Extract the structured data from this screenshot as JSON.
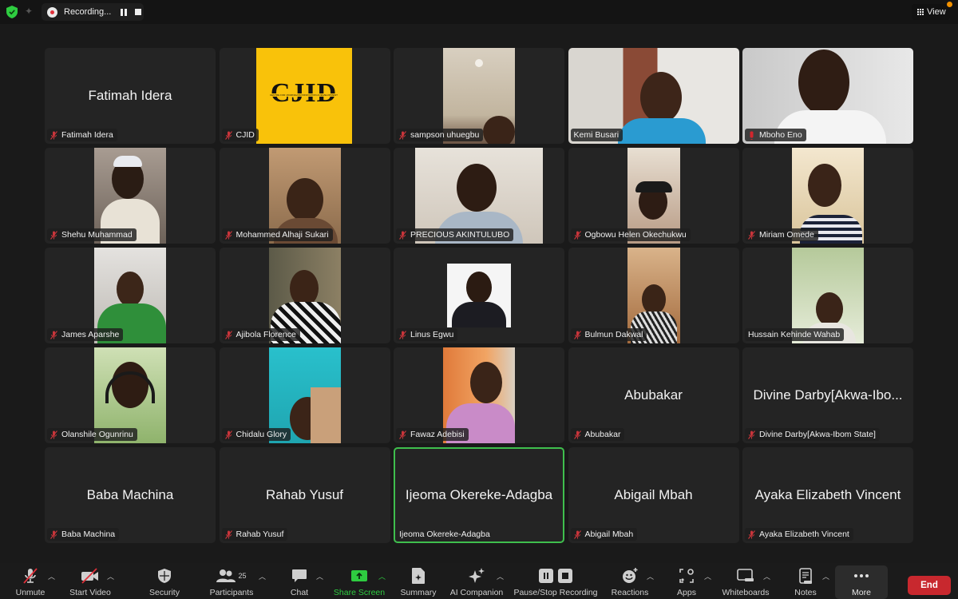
{
  "topbar": {
    "recording_label": "Recording...",
    "view_label": "View",
    "colors": {
      "shield": "#2ecc40",
      "rec_dot": "#e0303a",
      "notify_dot": "#f29100"
    }
  },
  "participants": [
    {
      "display_name": "Fatimah Idera",
      "label": "Fatimah Idera",
      "muted": true,
      "video": false
    },
    {
      "display_name": "CJID",
      "label": "CJID",
      "muted": true,
      "video": true,
      "logo_text": "CJID",
      "logo_subtitle": "CENTRE FOR JOURNALISM INNOVATION & DEVELOPMENT"
    },
    {
      "display_name": "sampson uhuegbu",
      "label": "sampson uhuegbu",
      "muted": true,
      "video": true
    },
    {
      "display_name": "Kemi Busari",
      "label": "Kemi Busari",
      "muted": false,
      "video": true
    },
    {
      "display_name": "Mboho Eno",
      "label": "Mboho Eno",
      "muted": true,
      "video": true,
      "speaking": true
    },
    {
      "display_name": "Shehu Muhammad",
      "label": "Shehu Muhammad",
      "muted": true,
      "video": true
    },
    {
      "display_name": "Mohammed Alhaji Sukari",
      "label": "Mohammed Alhaji Sukari",
      "muted": true,
      "video": true
    },
    {
      "display_name": "PRECIOUS AKINTULUBO",
      "label": "PRECIOUS AKINTULUBO",
      "muted": true,
      "video": true
    },
    {
      "display_name": "Ogbowu Helen Okechukwu",
      "label": "Ogbowu Helen Okechukwu",
      "muted": true,
      "video": true
    },
    {
      "display_name": "Miriam Omede",
      "label": "Miriam Omede",
      "muted": true,
      "video": true
    },
    {
      "display_name": "James Aparshe",
      "label": "James Aparshe",
      "muted": true,
      "video": true
    },
    {
      "display_name": "Ajibola Florence",
      "label": "Ajibola Florence",
      "muted": true,
      "video": true
    },
    {
      "display_name": "Linus Egwu",
      "label": "Linus Egwu",
      "muted": true,
      "video": true
    },
    {
      "display_name": "Bulmun Dakwal",
      "label": "Bulmun Dakwal",
      "muted": true,
      "video": true
    },
    {
      "display_name": "Hussain Kehinde Wahab",
      "label": "Hussain Kehinde Wahab",
      "muted": false,
      "video": true
    },
    {
      "display_name": "Olanshile Ogunrinu",
      "label": "Olanshile Ogunrinu",
      "muted": true,
      "video": true
    },
    {
      "display_name": "Chidalu Glory",
      "label": "Chidalu Glory",
      "muted": true,
      "video": true
    },
    {
      "display_name": "Fawaz Adebisi",
      "label": "Fawaz Adebisi",
      "muted": true,
      "video": true
    },
    {
      "display_name": "Abubakar",
      "label": "Abubakar",
      "muted": true,
      "video": false
    },
    {
      "display_name": "Divine Darby[Akwa-Ibo...",
      "label": "Divine Darby[Akwa-Ibom State]",
      "muted": true,
      "video": false
    },
    {
      "display_name": "Baba Machina",
      "label": "Baba Machina",
      "muted": true,
      "video": false
    },
    {
      "display_name": "Rahab Yusuf",
      "label": "Rahab Yusuf",
      "muted": true,
      "video": false
    },
    {
      "display_name": "Ijeoma Okereke-Adagba",
      "label": "Ijeoma Okereke-Adagba",
      "muted": false,
      "video": false,
      "active_speaker": true
    },
    {
      "display_name": "Abigail Mbah",
      "label": "Abigail Mbah",
      "muted": true,
      "video": false
    },
    {
      "display_name": "Ayaka Elizabeth Vincent",
      "label": "Ayaka Elizabeth Vincent",
      "muted": true,
      "video": false
    }
  ],
  "toolbar": {
    "unmute": "Unmute",
    "start_video": "Start Video",
    "security": "Security",
    "participants": "Participants",
    "participants_count": "25",
    "chat": "Chat",
    "share_screen": "Share Screen",
    "summary": "Summary",
    "ai_companion": "AI Companion",
    "pause_stop_recording": "Pause/Stop Recording",
    "reactions": "Reactions",
    "apps": "Apps",
    "whiteboards": "Whiteboards",
    "notes": "Notes",
    "more": "More",
    "end": "End",
    "colors": {
      "share_green": "#2ecc40",
      "end_red": "#c8282e",
      "active_outline": "#3fbf4d"
    }
  }
}
